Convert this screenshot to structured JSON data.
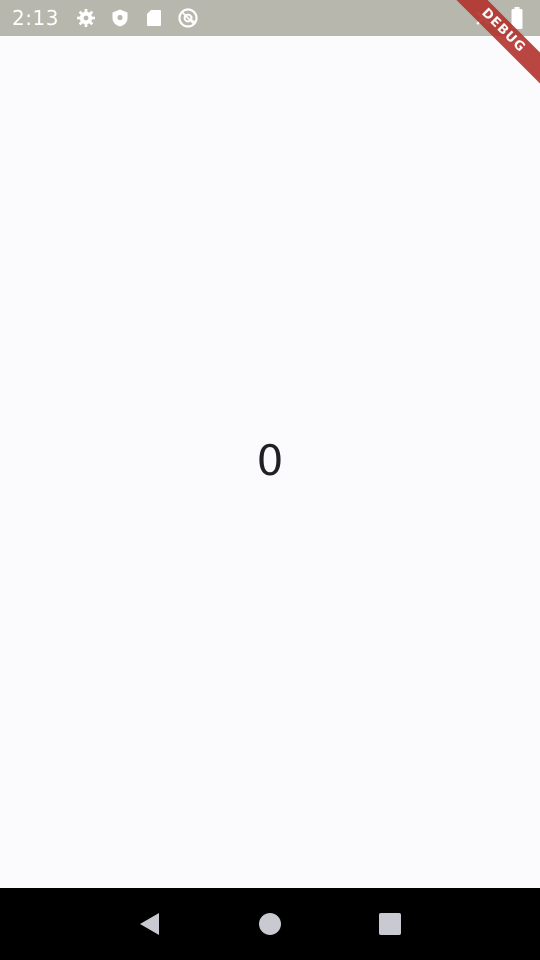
{
  "status_bar": {
    "time": "2:13",
    "icons": [
      "settings-icon",
      "shield-icon",
      "sd-card-icon",
      "at-sign-icon"
    ],
    "right_icons": [
      "signal-icon",
      "battery-icon"
    ]
  },
  "debug_banner": {
    "label": "DEBUG"
  },
  "main": {
    "counter_value": "0"
  },
  "nav_bar": {
    "buttons": [
      "back-icon",
      "home-icon",
      "recents-icon"
    ]
  },
  "colors": {
    "status_bar_bg": "#b7b7ae",
    "background": "#fbfbfe",
    "debug_ribbon": "#b3332d",
    "nav_bar_bg": "#000000",
    "nav_icon": "#c9c9d2"
  }
}
